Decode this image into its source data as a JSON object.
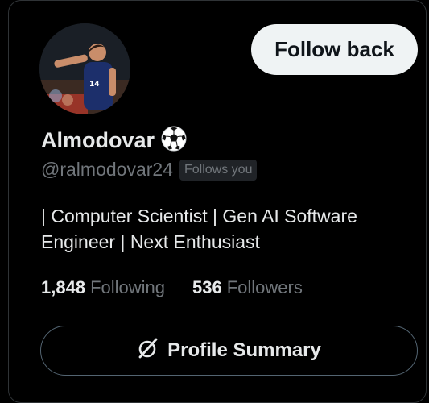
{
  "profile": {
    "display_name": "Almodovar",
    "name_emoji_icon": "soccer-ball-icon",
    "handle": "@ralmodovar24",
    "follows_you_badge": "Follows you",
    "bio_line1": "| Computer Scientist | Gen AI Software",
    "bio_line2": "Engineer | Next Enthusiast"
  },
  "actions": {
    "follow_back_label": "Follow back",
    "profile_summary_label": "Profile Summary",
    "profile_summary_icon": "grok-slash-circle-icon"
  },
  "stats": {
    "following_count": "1,848",
    "following_label": "Following",
    "followers_count": "536",
    "followers_label": "Followers"
  },
  "colors": {
    "background": "#000000",
    "primary_text": "#e7e9ea",
    "secondary_text": "#71767b",
    "follow_button_bg": "#eff3f4",
    "badge_bg": "#202327",
    "outline": "#536471"
  }
}
